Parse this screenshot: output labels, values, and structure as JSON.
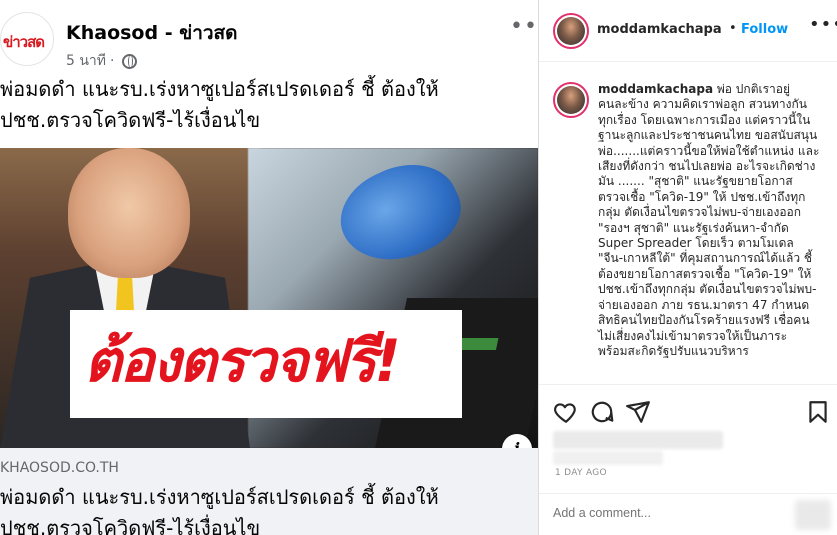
{
  "facebook": {
    "avatar_logo": "ข่าวสด",
    "page_name": "Khaosod - ข่าวสด",
    "time": "5 นาที",
    "separator": "·",
    "more_label": "•••",
    "post_text": "พ่อมดดำ แนะรบ.เร่งหาซูเปอร์สเปรดเดอร์ ชี้ ต้องให้ ปชช.ตรวจโควิดฟรี-ไร้เงื่อนไข",
    "image_overlay_text": "ต้องตรวจฟรี!",
    "info_label": "i",
    "link_domain": "KHAOSOD.CO.TH",
    "link_title": "พ่อมดดำ แนะรบ.เร่งหาซูเปอร์สเปรดเดอร์ ชี้ ต้องให้ ปชช.ตรวจโควิดฟรี-ไร้เงื่อนไข"
  },
  "instagram": {
    "username": "moddamkachapa",
    "dot": "•",
    "follow_label": "Follow",
    "more_label": "•••",
    "caption_user": "moddamkachapa",
    "caption_text": " พ่อ ปกติเราอยู่คนละข้าง ความคิดเราพ่อลูก สวนทางกัน ทุกเรื่อง โดยเฉพาะการเมือง แต่คราวนี้ในฐานะลูกและประชาชนคนไทย ขอสนับสนุนพ่อ.......แต่คราวนี้ขอให้พ่อใช้ตำแหน่ง และเสียงที่ดังกว่า ชนไปเลยพ่อ อะไรจะเกิดช่างมัน ....... \"สุชาติ\" แนะรัฐขยายโอกาสตรวจเชื้อ \"โควิด-19\" ให้ ปชช.เข้าถึงทุกกลุ่ม ตัดเงื่อนไขตรวจไม่พบ-จ่ายเองออก \"รองฯ สุชาติ\" แนะรัฐเร่งค้นหา-จำกัด Super Spreader โดยเร็ว ตามโมเดล \"จีน-เกาหลีใต้\" ที่คุมสถานการณ์ได้แล้ว ชี้ต้องขยายโอกาสตรวจเชื้อ \"โควิด-19\" ให้ ปชช.เข้าถึงทุกกลุ่ม ตัดเงื่อนไขตรวจไม่พบ-จ่ายเองออก ภาย รธน.มาตรา 47 กำหนดสิทธิคนไทยป้องกันโรคร้ายแรงฟรี เชื่อคนไม่เสี่ยงคงไม่เข้ามาตรวจให้เป็นภาระ พร้อมสะกิดรัฐปรับแนวบริหาร",
    "date": "1 DAY AGO",
    "comment_placeholder": "Add a comment...",
    "icons": [
      "heart-icon",
      "comment-icon",
      "share-icon",
      "bookmark-icon"
    ]
  }
}
